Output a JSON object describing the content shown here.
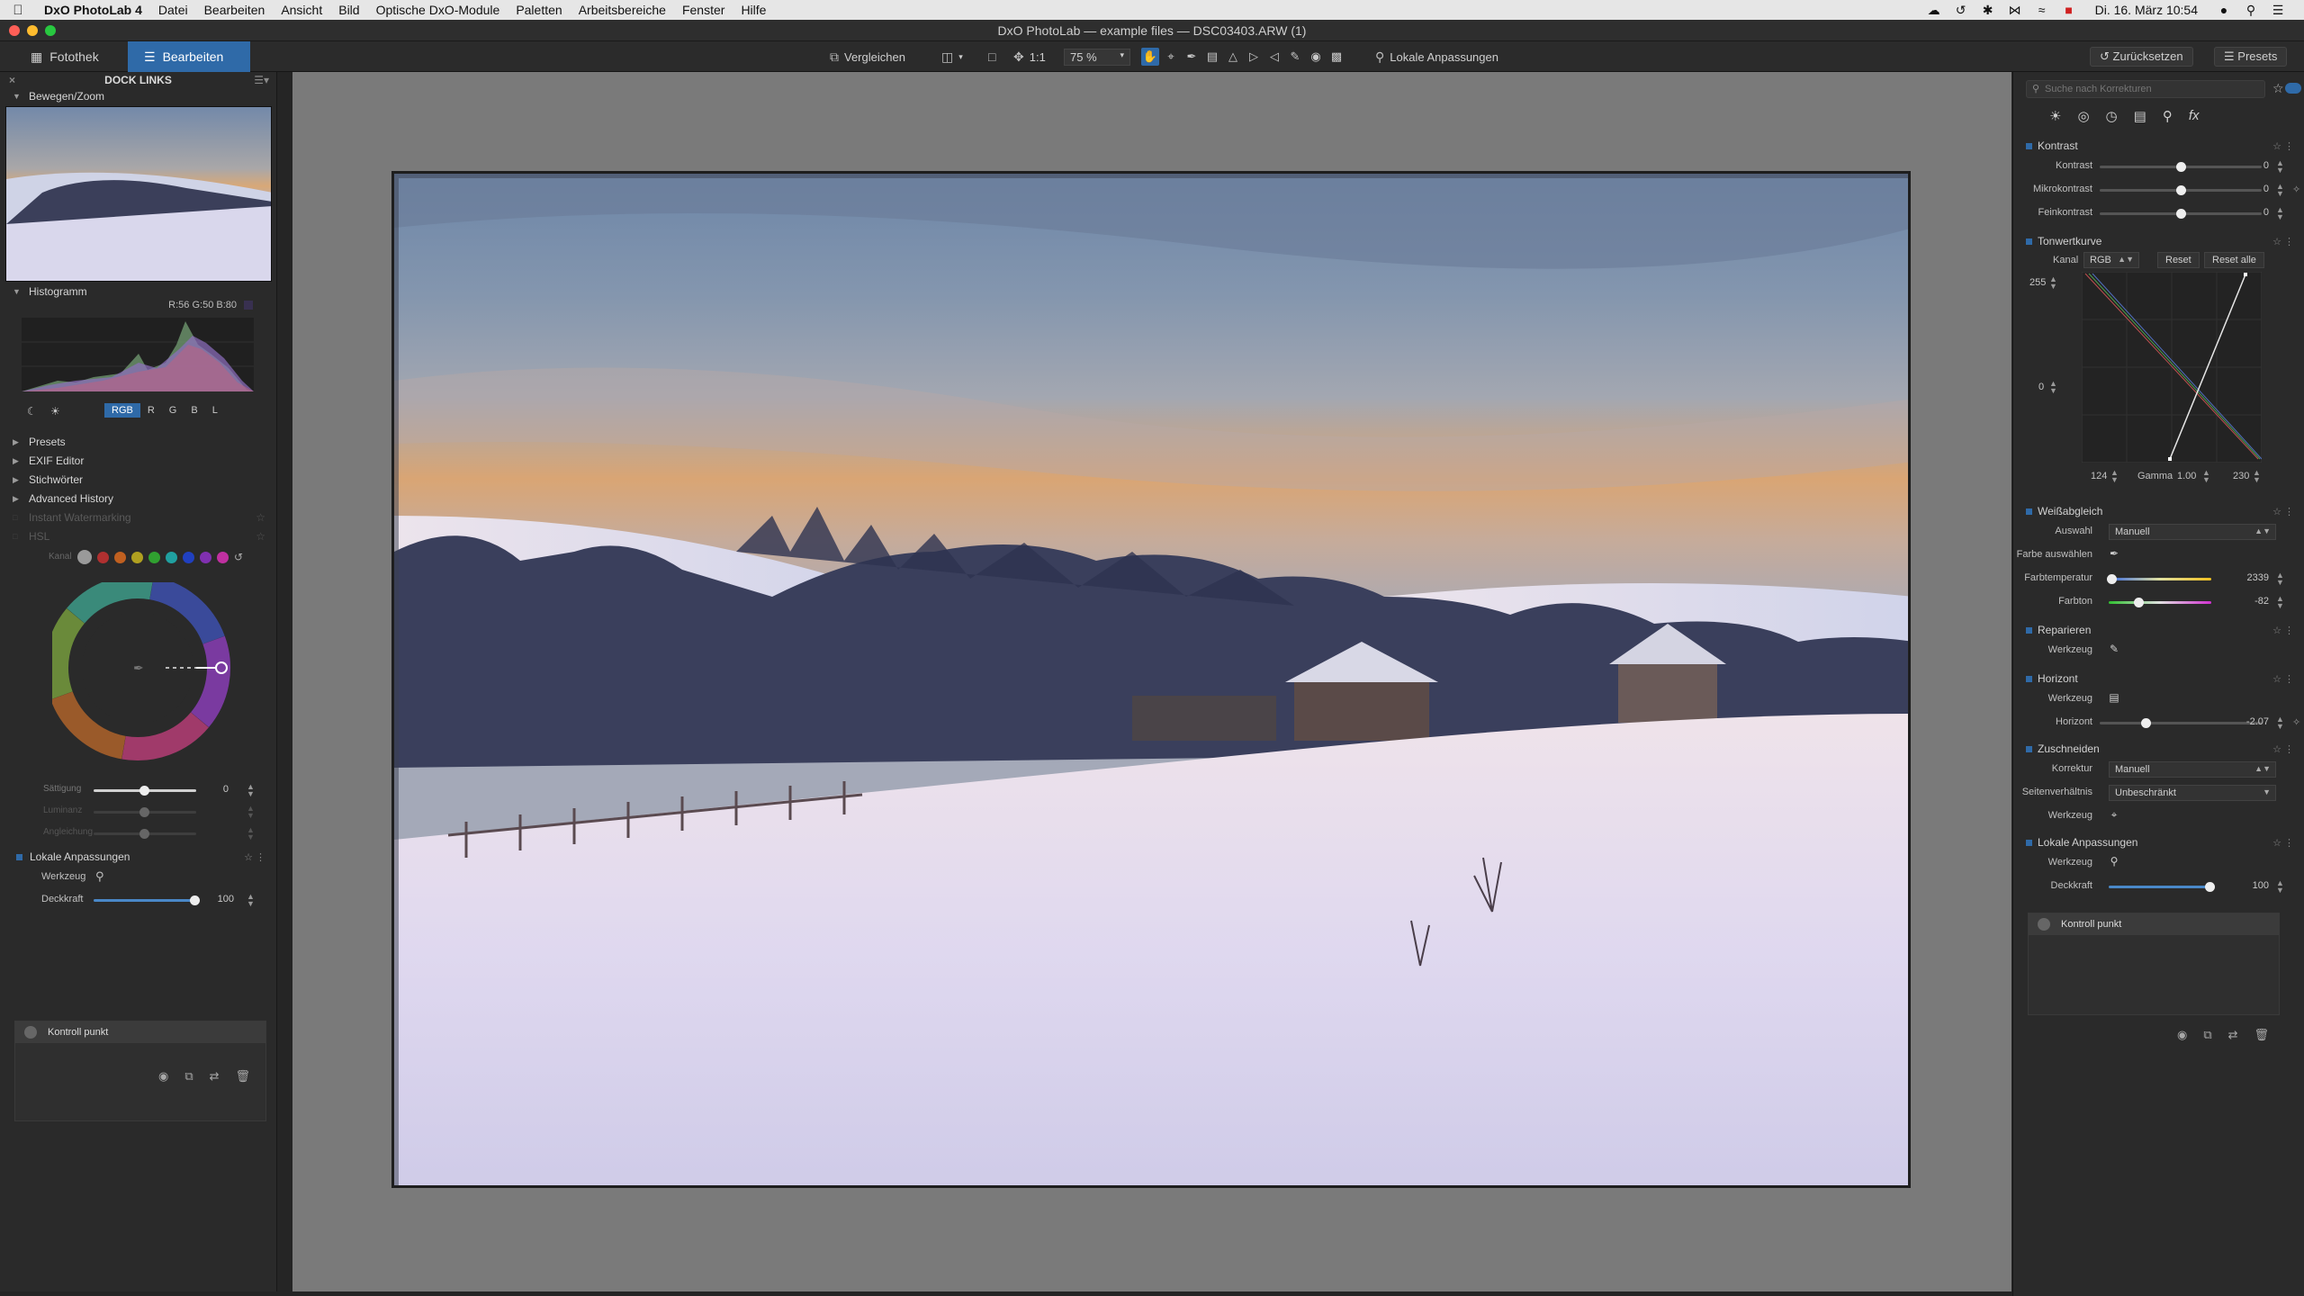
{
  "menubar": {
    "app": "DxO PhotoLab 4",
    "items": [
      "Datei",
      "Bearbeiten",
      "Ansicht",
      "Bild",
      "Optische DxO-Module",
      "Paletten",
      "Arbeitsbereiche",
      "Fenster",
      "Hilfe"
    ],
    "clock": "Di. 16. März  10:54"
  },
  "window": {
    "title": "DxO PhotoLab — example files — DSC03403.ARW (1)"
  },
  "toolbar": {
    "tab_library": "Fotothek",
    "tab_edit": "Bearbeiten",
    "compare": "Vergleichen",
    "one_to_one": "1:1",
    "zoom": "75 %",
    "local_adjust": "Lokale Anpassungen",
    "reset": "Zurücksetzen",
    "presets": "Presets"
  },
  "left": {
    "dock_title": "DOCK LINKS",
    "move_zoom": "Bewegen/Zoom",
    "histogram": "Histogramm",
    "rgb_readout": "R:56 G:50 B:80",
    "channels": [
      "RGB",
      "R",
      "G",
      "B",
      "L"
    ],
    "sections": [
      "Presets",
      "EXIF Editor",
      "Stichwörter",
      "Advanced History"
    ],
    "dim_sections": [
      "Instant Watermarking",
      "HSL"
    ],
    "hsl_channel_label": "Kanal",
    "saturation": {
      "label": "Sättigung",
      "value": "0"
    },
    "luminance": {
      "label": "Luminanz"
    },
    "uniformity": {
      "label": "Angleichung"
    },
    "local_adjust": {
      "title": "Lokale Anpassungen",
      "tool_label": "Werkzeug",
      "opacity_label": "Deckkraft",
      "opacity_value": "100",
      "control_point": "Kontroll punkt"
    }
  },
  "right": {
    "search_placeholder": "Suche nach Korrekturen",
    "contrast": {
      "title": "Kontrast",
      "rows": [
        {
          "label": "Kontrast",
          "value": "0"
        },
        {
          "label": "Mikrokontrast",
          "value": "0"
        },
        {
          "label": "Feinkontrast",
          "value": "0"
        }
      ]
    },
    "tone_curve": {
      "title": "Tonwertkurve",
      "channel_label": "Kanal",
      "channel": "RGB",
      "reset": "Reset",
      "reset_all": "Reset alle",
      "top_value": "255",
      "bottom_value": "0",
      "black_point": "124",
      "gamma_label": "Gamma",
      "gamma": "1.00",
      "white_point": "230"
    },
    "white_balance": {
      "title": "Weißabgleich",
      "select_label": "Auswahl",
      "select_value": "Manuell",
      "pick_label": "Farbe auswählen",
      "temp_label": "Farbtemperatur",
      "temp_value": "2339",
      "tint_label": "Farbton",
      "tint_value": "-82"
    },
    "repair": {
      "title": "Reparieren",
      "tool_label": "Werkzeug"
    },
    "horizon": {
      "title": "Horizont",
      "tool_label": "Werkzeug",
      "horizon_label": "Horizont",
      "horizon_value": "-2.07"
    },
    "crop": {
      "title": "Zuschneiden",
      "correction_label": "Korrektur",
      "correction_value": "Manuell",
      "ratio_label": "Seitenverhältnis",
      "ratio_value": "Unbeschränkt",
      "tool_label": "Werkzeug"
    },
    "local_adjust": {
      "title": "Lokale Anpassungen",
      "tool_label": "Werkzeug",
      "opacity_label": "Deckkraft",
      "opacity_value": "100",
      "control_point": "Kontroll punkt"
    }
  },
  "colors": {
    "accent": "#2f6aa8",
    "canvas": "#7a7a7a",
    "panel": "#2a2a2a"
  }
}
